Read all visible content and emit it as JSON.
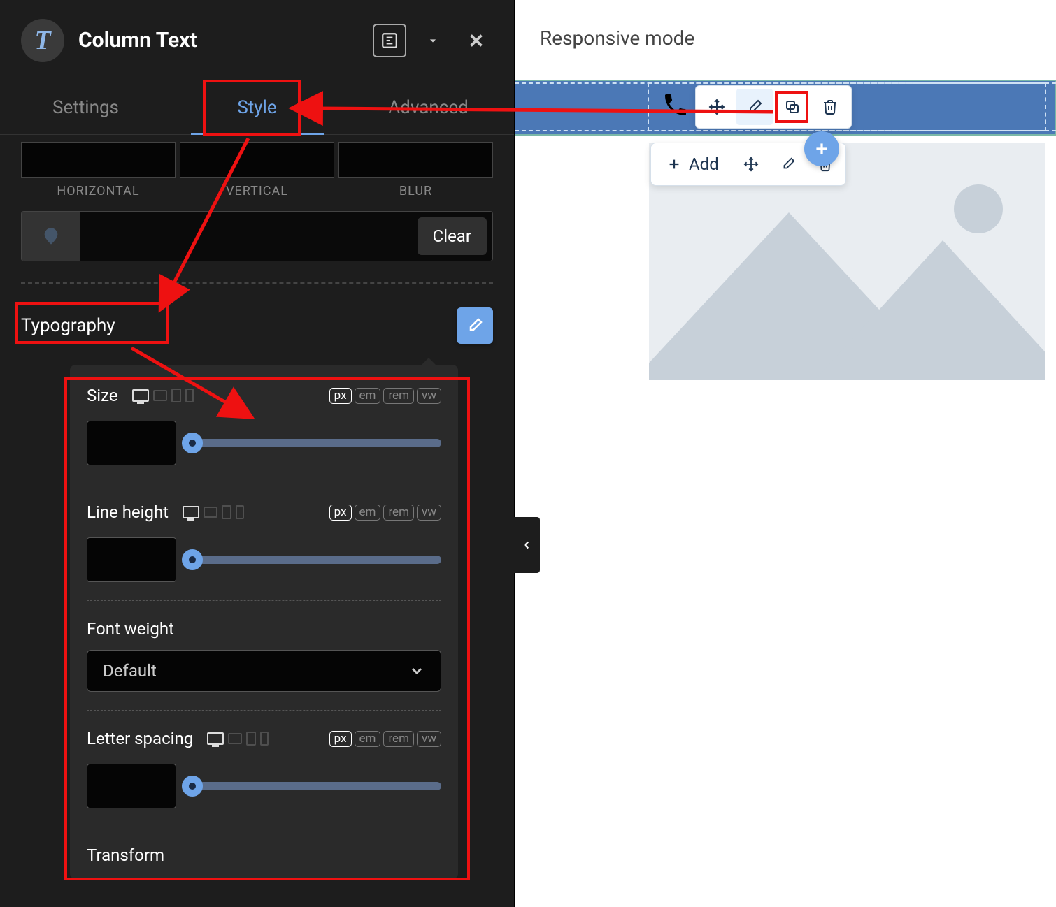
{
  "header": {
    "badge_letter": "T",
    "title": "Column Text"
  },
  "tabs": {
    "settings": "Settings",
    "style": "Style",
    "advanced": "Advanced",
    "active": "style"
  },
  "shadow": {
    "labels": {
      "horizontal": "HORIZONTAL",
      "vertical": "VERTICAL",
      "blur": "BLUR"
    },
    "clear": "Clear"
  },
  "typography": {
    "title": "Typography",
    "size_label": "Size",
    "line_height_label": "Line height",
    "font_weight_label": "Font weight",
    "font_weight_value": "Default",
    "letter_spacing_label": "Letter spacing",
    "transform_label": "Transform",
    "units": {
      "px": "px",
      "em": "em",
      "rem": "rem",
      "vw": "vw"
    }
  },
  "preview": {
    "responsive_label": "Responsive mode",
    "add_label": "Add"
  }
}
